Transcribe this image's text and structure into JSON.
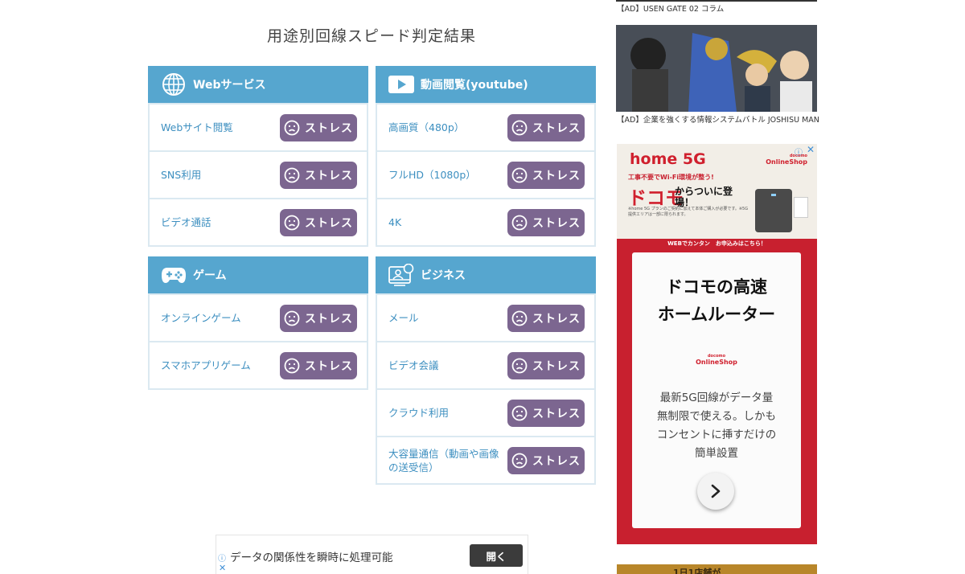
{
  "page_title": "用途別回線スピード判定結果",
  "stress_label": "ストレス",
  "categories": {
    "web": {
      "title": "Webサービス",
      "icon": "globe-icon",
      "items": [
        "Webサイト閲覧",
        "SNS利用",
        "ビデオ通話"
      ]
    },
    "video": {
      "title": "動画閲覧(youtube)",
      "icon": "play-icon",
      "items": [
        "高画質（480p）",
        "フルHD（1080p）",
        "4K"
      ]
    },
    "game": {
      "title": "ゲーム",
      "icon": "gamepad-icon",
      "items": [
        "オンラインゲーム",
        "スマホアプリゲーム"
      ]
    },
    "business": {
      "title": "ビジネス",
      "icon": "business-icon",
      "items": [
        "メール",
        "ビデオ会議",
        "クラウド利用",
        "大容量通信（動画や画像の送受信）"
      ]
    }
  },
  "sidebar_ads": {
    "top_caption": "【AD】USEN GATE 02 コラム",
    "second_caption": "【AD】企業を強くする情報システムバトル JOSHISU MAN",
    "docomo": {
      "logo": "home 5G",
      "shop_label": "OnlineShop",
      "shop_prefix": "docomo",
      "tagline": "工事不要でWi-Fi環境が整う!",
      "brand_big": "ドコモ",
      "brand_sub": "からついに登場！",
      "notes": "※home 5G プランのご契約に加えて本体ご購入が必要です。※5G提供エリアは一部に限られます。",
      "web_apply": "WEBでカンタン　お申込みはこちら！",
      "title_line1": "ドコモの高速",
      "title_line2": "ホームルーター",
      "desc_line1": "最新5G回線がデータ量",
      "desc_line2": "無制限で使える。しかも",
      "desc_line3": "コンセントに挿すだけの",
      "desc_line4": "簡単設置"
    },
    "bottom_strip_text": "1日1店舗が"
  },
  "bottom_bar": {
    "text": "データの関係性を瞬時に処理可能",
    "button": "開く"
  },
  "colors": {
    "header_blue": "#56a6cf",
    "stress_purple": "#7c6690",
    "label_blue": "#3d8fc0"
  }
}
